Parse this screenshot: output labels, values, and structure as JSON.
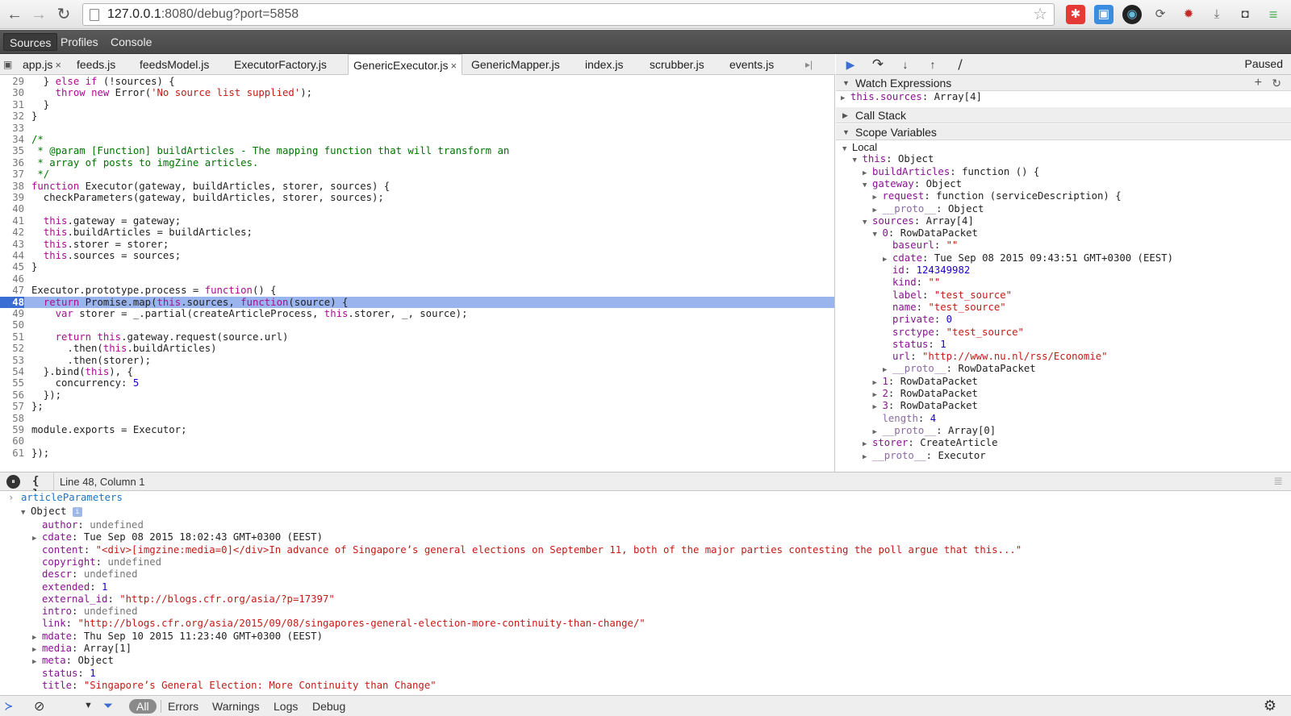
{
  "browser": {
    "url_host": "127.0.0.1",
    "url_rest": ":8080/debug?port=5858",
    "back_icon": "←",
    "forward_icon": "→",
    "reload_icon": "↻"
  },
  "devtools_tabs": [
    "Sources",
    "Profiles",
    "Console"
  ],
  "file_tabs": [
    "app.js",
    "feeds.js",
    "feedsModel.js",
    "ExecutorFactory.js",
    "GenericExecutor.js",
    "GenericMapper.js",
    "index.js",
    "scrubber.js",
    "events.js"
  ],
  "active_file": "GenericExecutor.js",
  "close_glyph": "×",
  "paused_label": "Paused",
  "code": [
    {
      "n": "29",
      "t": "  } else if (!sources) {"
    },
    {
      "n": "30",
      "t": "    throw new Error('No source list supplied');"
    },
    {
      "n": "31",
      "t": "  }"
    },
    {
      "n": "32",
      "t": "}"
    },
    {
      "n": "33",
      "t": ""
    },
    {
      "n": "34",
      "t": "/*"
    },
    {
      "n": "35",
      "t": " * @param [Function] buildArticles - The mapping function that will transform an"
    },
    {
      "n": "36",
      "t": " * array of posts to imgZine articles."
    },
    {
      "n": "37",
      "t": " */"
    },
    {
      "n": "38",
      "t": "function Executor(gateway, buildArticles, storer, sources) {"
    },
    {
      "n": "39",
      "t": "  checkParameters(gateway, buildArticles, storer, sources);"
    },
    {
      "n": "40",
      "t": ""
    },
    {
      "n": "41",
      "t": "  this.gateway = gateway;"
    },
    {
      "n": "42",
      "t": "  this.buildArticles = buildArticles;"
    },
    {
      "n": "43",
      "t": "  this.storer = storer;"
    },
    {
      "n": "44",
      "t": "  this.sources = sources;"
    },
    {
      "n": "45",
      "t": "}"
    },
    {
      "n": "46",
      "t": ""
    },
    {
      "n": "47",
      "t": "Executor.prototype.process = function() {"
    },
    {
      "n": "48",
      "t": "  return Promise.map(this.sources, function(source) {"
    },
    {
      "n": "49",
      "t": "    var storer = _.partial(createArticleProcess, this.storer, _, source);"
    },
    {
      "n": "50",
      "t": ""
    },
    {
      "n": "51",
      "t": "    return this.gateway.request(source.url)"
    },
    {
      "n": "52",
      "t": "      .then(this.buildArticles)"
    },
    {
      "n": "53",
      "t": "      .then(storer);"
    },
    {
      "n": "54",
      "t": "  }.bind(this), {"
    },
    {
      "n": "55",
      "t": "    concurrency: 5"
    },
    {
      "n": "56",
      "t": "  });"
    },
    {
      "n": "57",
      "t": "};"
    },
    {
      "n": "58",
      "t": ""
    },
    {
      "n": "59",
      "t": "module.exports = Executor;"
    },
    {
      "n": "60",
      "t": ""
    },
    {
      "n": "61",
      "t": "});"
    }
  ],
  "highlight_line": "48",
  "sections": {
    "watch": "Watch Expressions",
    "callstack": "Call Stack",
    "scope": "Scope Variables"
  },
  "watch_item": {
    "k": "this.sources",
    "v": "Array[4]"
  },
  "scope_tree": [
    {
      "d": 0,
      "tri": "▼",
      "k": "Local",
      "v": "",
      "kc": "plain"
    },
    {
      "d": 1,
      "tri": "▼",
      "k": "this",
      "v": "Object"
    },
    {
      "d": 2,
      "tri": "▶",
      "k": "buildArticles",
      "v": "function () {"
    },
    {
      "d": 2,
      "tri": "▼",
      "k": "gateway",
      "v": "Object"
    },
    {
      "d": 3,
      "tri": "▶",
      "k": "request",
      "v": "function (serviceDescription) {"
    },
    {
      "d": 3,
      "tri": "▶",
      "k": "__proto__",
      "v": "Object",
      "kc": "dim"
    },
    {
      "d": 2,
      "tri": "▼",
      "k": "sources",
      "v": "Array[4]"
    },
    {
      "d": 3,
      "tri": "▼",
      "k": "0",
      "v": "RowDataPacket"
    },
    {
      "d": 4,
      "tri": "",
      "k": "baseurl",
      "v": "\"\"",
      "vc": "s2"
    },
    {
      "d": 4,
      "tri": "▶",
      "k": "cdate",
      "v": "Tue Sep 08 2015 09:43:51 GMT+0300 (EEST)"
    },
    {
      "d": 4,
      "tri": "",
      "k": "id",
      "v": "124349982",
      "vc": "num2"
    },
    {
      "d": 4,
      "tri": "",
      "k": "kind",
      "v": "\"\"",
      "vc": "s2"
    },
    {
      "d": 4,
      "tri": "",
      "k": "label",
      "v": "\"test_source\"",
      "vc": "s2"
    },
    {
      "d": 4,
      "tri": "",
      "k": "name",
      "v": "\"test_source\"",
      "vc": "s2"
    },
    {
      "d": 4,
      "tri": "",
      "k": "private",
      "v": "0",
      "vc": "num2"
    },
    {
      "d": 4,
      "tri": "",
      "k": "srctype",
      "v": "\"test_source\"",
      "vc": "s2"
    },
    {
      "d": 4,
      "tri": "",
      "k": "status",
      "v": "1",
      "vc": "num2"
    },
    {
      "d": 4,
      "tri": "",
      "k": "url",
      "v": "\"http://www.nu.nl/rss/Economie\"",
      "vc": "s2"
    },
    {
      "d": 4,
      "tri": "▶",
      "k": "__proto__",
      "v": "RowDataPacket",
      "kc": "dim"
    },
    {
      "d": 3,
      "tri": "▶",
      "k": "1",
      "v": "RowDataPacket"
    },
    {
      "d": 3,
      "tri": "▶",
      "k": "2",
      "v": "RowDataPacket"
    },
    {
      "d": 3,
      "tri": "▶",
      "k": "3",
      "v": "RowDataPacket"
    },
    {
      "d": 3,
      "tri": "",
      "k": "length",
      "v": "4",
      "kc": "dim",
      "vc": "num2"
    },
    {
      "d": 3,
      "tri": "▶",
      "k": "__proto__",
      "v": "Array[0]",
      "kc": "dim"
    },
    {
      "d": 2,
      "tri": "▶",
      "k": "storer",
      "v": "CreateArticle"
    },
    {
      "d": 2,
      "tri": "▶",
      "k": "__proto__",
      "v": "Executor",
      "kc": "dim"
    }
  ],
  "status": {
    "position": "Line 48, Column 1",
    "braces": "{ }"
  },
  "console": {
    "prompt": "›",
    "input": "articleParameters",
    "root": "Object",
    "info_icon": "i",
    "lines": [
      {
        "tri": "",
        "k": "author",
        "v": "undefined",
        "vc": "grey"
      },
      {
        "tri": "▶",
        "k": "cdate",
        "v": "Tue Sep 08 2015 18:02:43 GMT+0300 (EEST)",
        "vc": "plain"
      },
      {
        "tri": "",
        "k": "content",
        "v": "\"<div>[imgzine:media=0]</div>In advance of Singapore’s general elections on September 11, both of the major parties contesting the poll argue that this...\"",
        "vc": "s2"
      },
      {
        "tri": "",
        "k": "copyright",
        "v": "undefined",
        "vc": "grey"
      },
      {
        "tri": "",
        "k": "descr",
        "v": "undefined",
        "vc": "grey"
      },
      {
        "tri": "",
        "k": "extended",
        "v": "1",
        "vc": "num2"
      },
      {
        "tri": "",
        "k": "external_id",
        "v": "\"http://blogs.cfr.org/asia/?p=17397\"",
        "vc": "s2"
      },
      {
        "tri": "",
        "k": "intro",
        "v": "undefined",
        "vc": "grey"
      },
      {
        "tri": "",
        "k": "link",
        "v": "\"http://blogs.cfr.org/asia/2015/09/08/singapores-general-election-more-continuity-than-change/\"",
        "vc": "s2"
      },
      {
        "tri": "▶",
        "k": "mdate",
        "v": "Thu Sep 10 2015 11:23:40 GMT+0300 (EEST)",
        "vc": "plain"
      },
      {
        "tri": "▶",
        "k": "media",
        "v": "Array[1]",
        "vc": "plain"
      },
      {
        "tri": "▶",
        "k": "meta",
        "v": "Object",
        "vc": "plain"
      },
      {
        "tri": "",
        "k": "status",
        "v": "1",
        "vc": "num2"
      },
      {
        "tri": "",
        "k": "title",
        "v": "\"Singapore’s General Election: More Continuity than Change\"",
        "vc": "s2"
      }
    ]
  },
  "console_filters": [
    "All",
    "Errors",
    "Warnings",
    "Logs",
    "Debug"
  ],
  "icons": {
    "resume": "▶",
    "step_over": "↷",
    "step_into": "↓",
    "step_out": "↑",
    "deactivate": "⧸",
    "add": "+",
    "refresh": "↻",
    "pause": "⏸",
    "clear": "⊘",
    "filter": "▼",
    "settings": "⚙",
    "drawer": "≣"
  },
  "colors": {
    "highlight": "#9ab4ee",
    "line_marker": "#3b6ed4",
    "keyword": "#aa0d91",
    "string": "#c41a16",
    "comment": "#007400",
    "number": "#1c00cf"
  }
}
